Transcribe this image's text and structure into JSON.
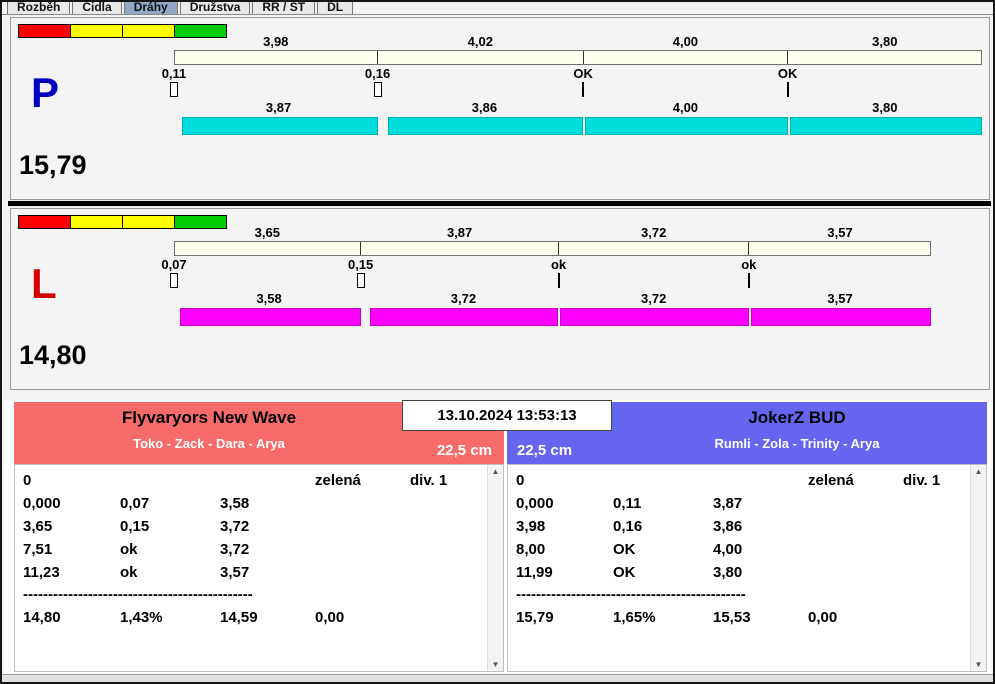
{
  "tabs": [
    {
      "label": "Rozběh",
      "selected": false
    },
    {
      "label": "Čidla",
      "selected": false
    },
    {
      "label": "Dráhy",
      "selected": true
    },
    {
      "label": "Družstva",
      "selected": false
    },
    {
      "label": "RR / ST",
      "selected": false
    },
    {
      "label": "DL",
      "selected": false
    }
  ],
  "lights": [
    "#ff0000",
    "#ffff00",
    "#ffff00",
    "#00cc00"
  ],
  "lanes": [
    {
      "letter": "P",
      "letter_color": "#0000c0",
      "bar_color": "#00dcdc",
      "total": "15,79",
      "segment_times": [
        "3,98",
        "4,02",
        "4,00",
        "3,80"
      ],
      "start_labels": [
        "0,11",
        "0,16",
        "OK",
        "OK"
      ],
      "start_marker_types": [
        "box",
        "box",
        "line",
        "line"
      ],
      "run_times": [
        "3,87",
        "3,86",
        "4,00",
        "3,80"
      ]
    },
    {
      "letter": "L",
      "letter_color": "#d00000",
      "bar_color": "#ff00ff",
      "total": "14,80",
      "segment_times": [
        "3,65",
        "3,87",
        "3,72",
        "3,57"
      ],
      "start_labels": [
        "0,07",
        "0,15",
        "ok",
        "ok"
      ],
      "start_marker_types": [
        "box",
        "box",
        "line",
        "line"
      ],
      "run_times": [
        "3,58",
        "3,72",
        "3,72",
        "3,57"
      ]
    }
  ],
  "datetime": "13.10.2024 13:53:13",
  "teams": [
    {
      "name": "Flyvaryors New Wave",
      "dogs": "Toko - Zack - Dara - Arya",
      "jump_height": "22,5 cm",
      "header_color": "#f76b6b",
      "status_row": {
        "col1": "0",
        "col4": "zelená",
        "col5": "div. 1"
      },
      "rows": [
        [
          "0,000",
          "0,07",
          "3,58"
        ],
        [
          "3,65",
          "0,15",
          "3,72"
        ],
        [
          "7,51",
          "ok",
          "3,72"
        ],
        [
          "11,23",
          "ok",
          "3,57"
        ]
      ],
      "separator": "----------------------------------------------",
      "totals": [
        "14,80",
        "1,43%",
        "14,59",
        "0,00"
      ]
    },
    {
      "name": "JokerZ BUD",
      "dogs": "Rumli - Zola - Trinity - Arya",
      "jump_height": "22,5 cm",
      "header_color": "#6565f0",
      "status_row": {
        "col1": "0",
        "col4": "zelená",
        "col5": "div. 1"
      },
      "rows": [
        [
          "0,000",
          "0,11",
          "3,87"
        ],
        [
          "3,98",
          "0,16",
          "3,86"
        ],
        [
          "8,00",
          "OK",
          "4,00"
        ],
        [
          "11,99",
          "OK",
          "3,80"
        ]
      ],
      "separator": "----------------------------------------------",
      "totals": [
        "15,79",
        "1,65%",
        "15,53",
        "0,00"
      ]
    }
  ]
}
